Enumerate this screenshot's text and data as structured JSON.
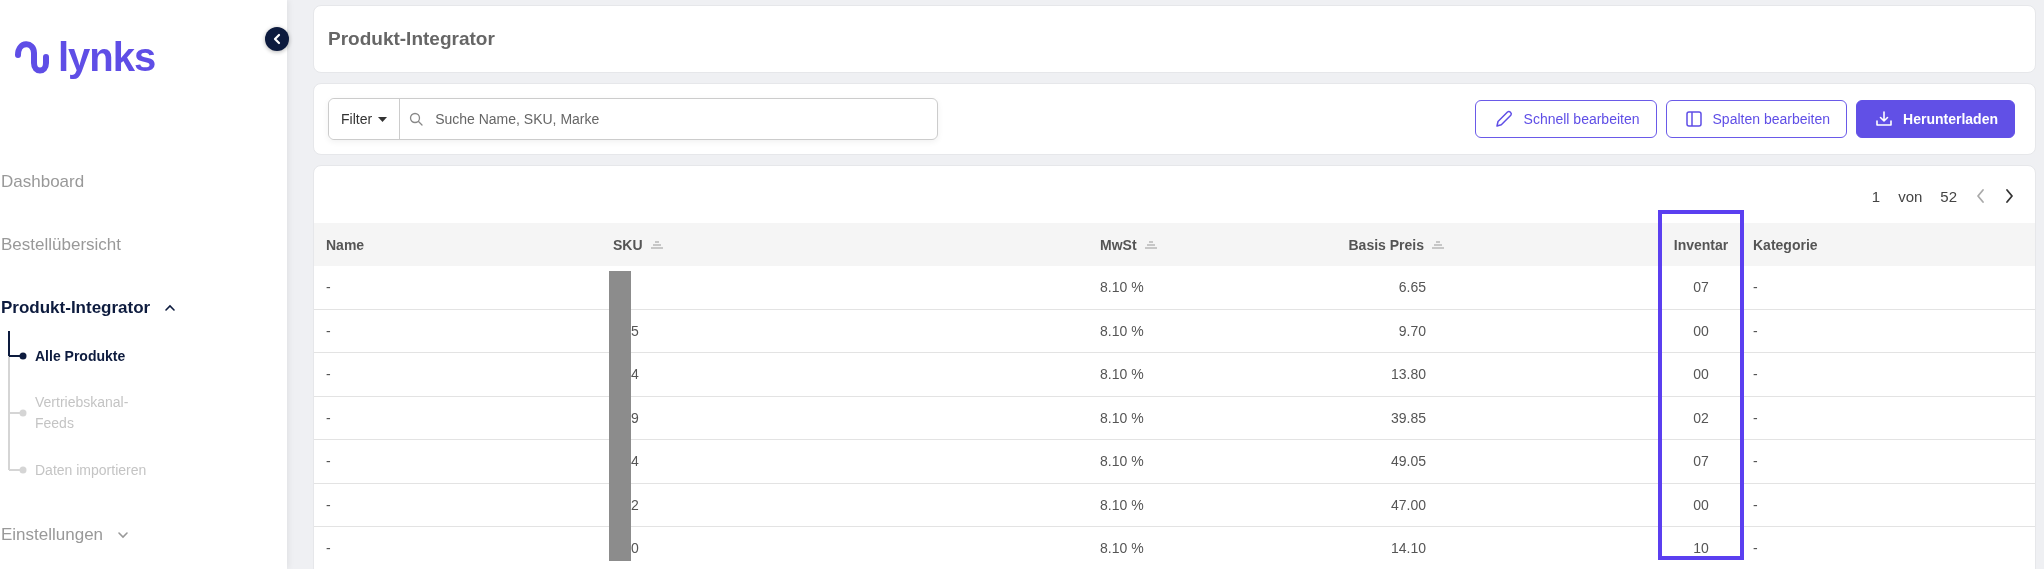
{
  "sidebar": {
    "logo": "lynks",
    "items": [
      {
        "label": "Dashboard",
        "selected": false
      },
      {
        "label": "Bestellübersicht",
        "selected": false
      },
      {
        "label": "Produkt-Integrator",
        "selected": true,
        "expanded": true,
        "children": [
          {
            "label": "Alle Produkte",
            "selected": true
          },
          {
            "label": "Vertriebskanal-Feeds",
            "selected": false
          },
          {
            "label": "Daten importieren",
            "selected": false
          }
        ]
      },
      {
        "label": "Einstellungen",
        "selected": false,
        "expanded": false
      }
    ]
  },
  "header": {
    "title": "Produkt-Integrator"
  },
  "toolbar": {
    "filter": "Filter",
    "search": {
      "placeholder": "Suche Name, SKU, Marke"
    },
    "buttons": [
      {
        "label": "Schnell bearbeiten",
        "kind": "outline"
      },
      {
        "label": "Spalten bearbeiten",
        "kind": "outline"
      },
      {
        "label": "Herunterladen",
        "kind": "primary"
      }
    ]
  },
  "pagination": {
    "page": "1",
    "of": "von",
    "total": "52",
    "prev": {
      "disabled": true
    },
    "next": {
      "disabled": false
    }
  },
  "table": {
    "columns": [
      {
        "label": "Name",
        "sortable": false,
        "highlighted": false,
        "redacted": false
      },
      {
        "label": "SKU",
        "sortable": true,
        "highlighted": false,
        "redacted": true
      },
      {
        "label": "MwSt",
        "sortable": true,
        "highlighted": false,
        "redacted": false
      },
      {
        "label": "Basis Preis",
        "sortable": true,
        "highlighted": false,
        "redacted": false
      },
      {
        "label": "Inventar",
        "sortable": false,
        "highlighted": true,
        "redacted": false
      },
      {
        "label": "Kategorie",
        "sortable": false,
        "highlighted": false,
        "redacted": false
      }
    ],
    "rows": [
      [
        "-",
        "",
        "8.10 %",
        "6.65",
        "07",
        "-"
      ],
      [
        "-",
        "5",
        "8.10 %",
        "9.70",
        "00",
        "-"
      ],
      [
        "-",
        "4",
        "8.10 %",
        "13.80",
        "00",
        "-"
      ],
      [
        "-",
        "9",
        "8.10 %",
        "39.85",
        "02",
        "-"
      ],
      [
        "-",
        "4",
        "8.10 %",
        "49.05",
        "07",
        "-"
      ],
      [
        "-",
        "2",
        "8.10 %",
        "47.00",
        "00",
        "-"
      ],
      [
        "-",
        "0",
        "8.10 %",
        "14.10",
        "10",
        "-"
      ]
    ]
  }
}
